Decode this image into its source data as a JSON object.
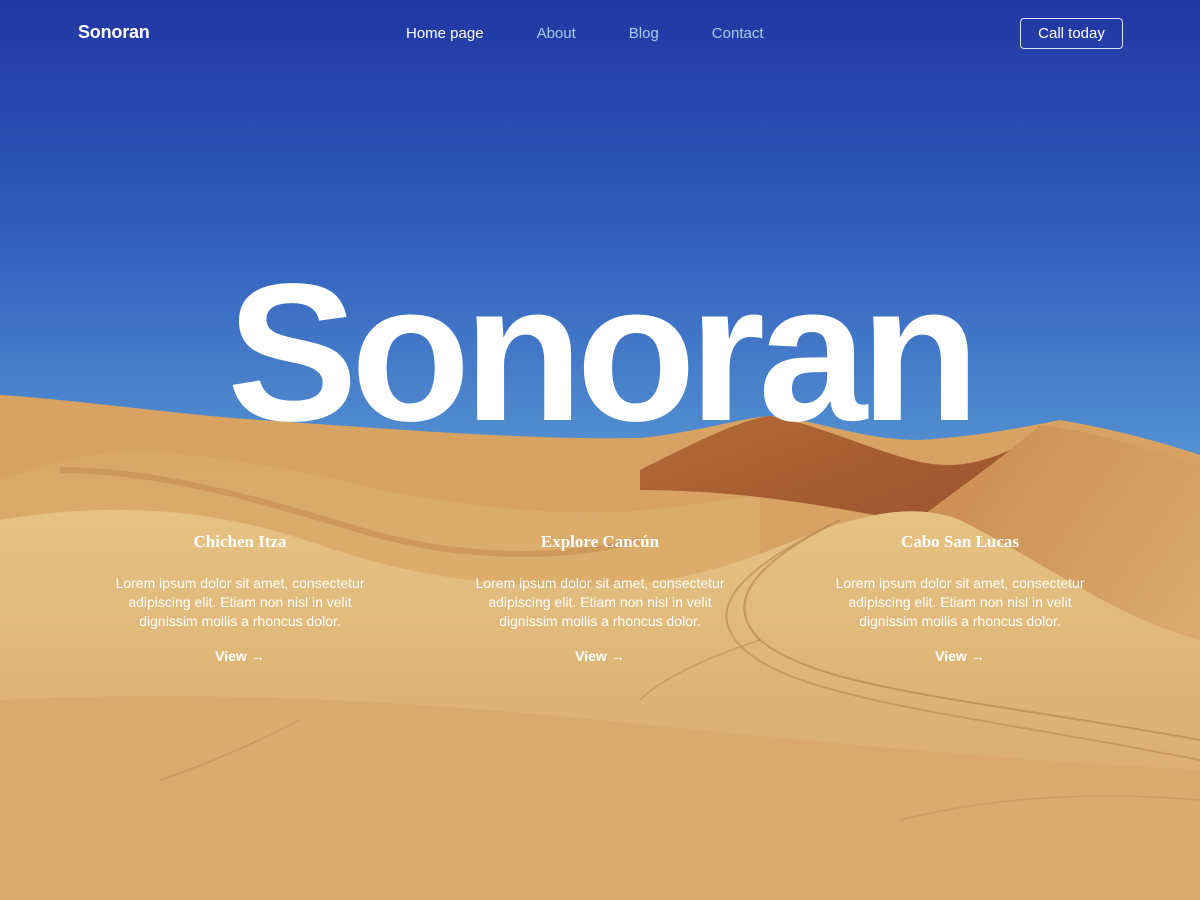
{
  "nav": {
    "brand": "Sonoran",
    "items": [
      {
        "label": "Home page",
        "active": true
      },
      {
        "label": "About",
        "active": false
      },
      {
        "label": "Blog",
        "active": false
      },
      {
        "label": "Contact",
        "active": false
      }
    ],
    "cta_label": "Call today"
  },
  "hero": {
    "title": "Sonoran"
  },
  "cards": [
    {
      "title": "Chichen Itza",
      "body": "Lorem ipsum dolor sit amet, consectetur adipiscing elit. Etiam non nisl in velit dignissim mollis a rhoncus dolor.",
      "link_label": "View",
      "link_icon": "arrow-right-icon"
    },
    {
      "title": "Explore Cancún",
      "body": "Lorem ipsum dolor sit amet, consectetur adipiscing elit. Etiam non nisl in velit dignissim mollis a rhoncus dolor.",
      "link_label": "View",
      "link_icon": "arrow-right-icon"
    },
    {
      "title": "Cabo San Lucas",
      "body": "Lorem ipsum dolor sit amet, consectetur adipiscing elit. Etiam non nisl in velit dignissim mollis a rhoncus dolor.",
      "link_label": "View",
      "link_icon": "arrow-right-icon"
    }
  ],
  "colors": {
    "sky_top": "#2236a3",
    "sky_mid": "#3c7ccc",
    "sky_horizon": "#9cc8dc",
    "sand_light": "#e6c07e",
    "sand_mid": "#d4a262",
    "sand_shadow": "#a0552e",
    "nav_inactive": "#a9cdf0",
    "text": "#ffffff"
  }
}
